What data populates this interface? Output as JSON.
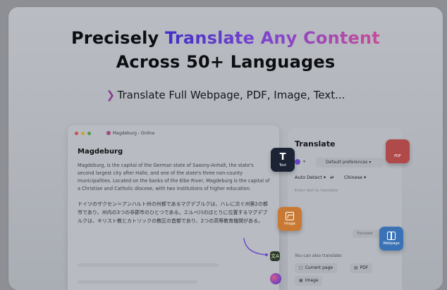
{
  "hero": {
    "line1_pre": "Precisely ",
    "line1_highlight": "Translate Any Content",
    "line2": "Across 50+ Languages",
    "subline": "Translate Full Webpage, PDF, Image, Text..."
  },
  "document": {
    "tab_title": "Magdeburg - Online",
    "heading": "Magdeburg",
    "paragraph_en": "Magdeburg, is the capital of the German state of Saxony-Anhalt, the state's second largest city after Halle, and one of the state's three non-county municipalities. Located on the banks of the Elbe River, Magdeburg is the capital of a Christian and Catholic diocese, with two institutions of higher education.",
    "paragraph_jp": "ドイツのザクセン＝アンハルト州の州都であるマグデブルクは、ハレに次ぐ州第2の都市であり、州内の3つの非郡市のひとつである。エルベ川のほとりに位置するマグデブルクは、キリスト教とカトリックの教区の首都であり、2つの高等教育機関がある。"
  },
  "panel": {
    "title": "Translate",
    "preferences": "Default preferences",
    "source_lang": "Auto Detect",
    "swap_glyph": "⇄",
    "target_lang": "Chinese",
    "input_placeholder": "Enter text to translate",
    "translate_button": "Translate",
    "also_label": "You can also translate:",
    "chip_current": "Current page",
    "chip_pdf": "PDF",
    "chip_image": "Image"
  },
  "fabs": {
    "text": "Text",
    "pdf": "PDF",
    "image": "Image",
    "webpage": "Webpage"
  },
  "colors": {
    "headline_gradient_start": "#3f2fc7",
    "headline_gradient_end": "#c84c99",
    "text_fab": "#1b2334",
    "pdf_fab": "#b04a4a",
    "image_fab": "#c87a35",
    "web_fab": "#3a73b5"
  }
}
